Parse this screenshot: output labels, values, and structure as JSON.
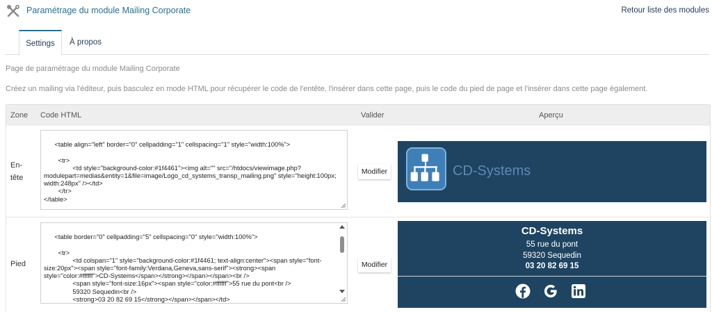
{
  "header": {
    "title": "Paramétrage du module Mailing Corporate",
    "back_link": "Retour liste des modules",
    "icon": "tools-icon"
  },
  "tabs": [
    {
      "label": "Settings",
      "active": true
    },
    {
      "label": "À propos",
      "active": false
    }
  ],
  "description": {
    "line1": "Page de paramétrage du module Mailing Corporate",
    "line2": "Créez un mailing via l'éditeur, puis basculez en mode HTML pour récupérer le code de l'entête, l'insérer dans cette page, puis le code du pied de page et l'insérer dans cette page également."
  },
  "table": {
    "headers": {
      "zone": "Zone",
      "code": "Code HTML",
      "valider": "Valider",
      "apercu": "Aperçu"
    },
    "rows": [
      {
        "zone": "En-tête",
        "code": "<table align=\"left\" border=\"0\" cellpadding=\"1\" cellspacing=\"1\" style=\"width:100%\">\n\n\t<tr>\n\t\t<td style=\"background-color:#1f4461\"><img alt=\"\" src=\"/htdocs/viewimage.php?modulepart=medias&entity=1&file=image/Logo_cd_systems_transp_mailing.png\" style=\"height:100px; width:248px\" /></td>\n\t</tr>\n</table>",
        "button": "Modifier"
      },
      {
        "zone": "Pied",
        "code": "<table border=\"0\" cellpadding=\"5\" cellspacing=\"0\" style=\"width:100%\">\n\n\t<tr>\n\t\t<td colspan=\"1\" style=\"background-color:#1f4461; text-align:center\"><span style=\"font-size:20px\"><span style=\"font-family:Verdana,Geneva,sans-serif\"><strong><span style=\"color:#ffffff\">CD-Systems</span></strong></span></span><br />\n\t\t<span style=\"font-size:16px\"><span style=\"color:#ffffff\">55 rue du pont<br />\n\t\t59320 Sequedin<br />\n\t\t<strong>03 20 82 69 15</strong></span></span></td>\n\t</tr>",
        "button": "Modifier"
      }
    ]
  },
  "preview": {
    "header_logo_text": "CD-Systems",
    "footer": {
      "name": "CD-Systems",
      "street": "55 rue du pont",
      "city": "59320 Sequedin",
      "phone": "03 20 82 69 15",
      "social_icons": [
        "facebook-icon",
        "google-icon",
        "linkedin-icon"
      ]
    }
  },
  "colors": {
    "preview_bg": "#1f4461",
    "title_color": "#2b6f8d",
    "link_color": "#263c5c"
  }
}
